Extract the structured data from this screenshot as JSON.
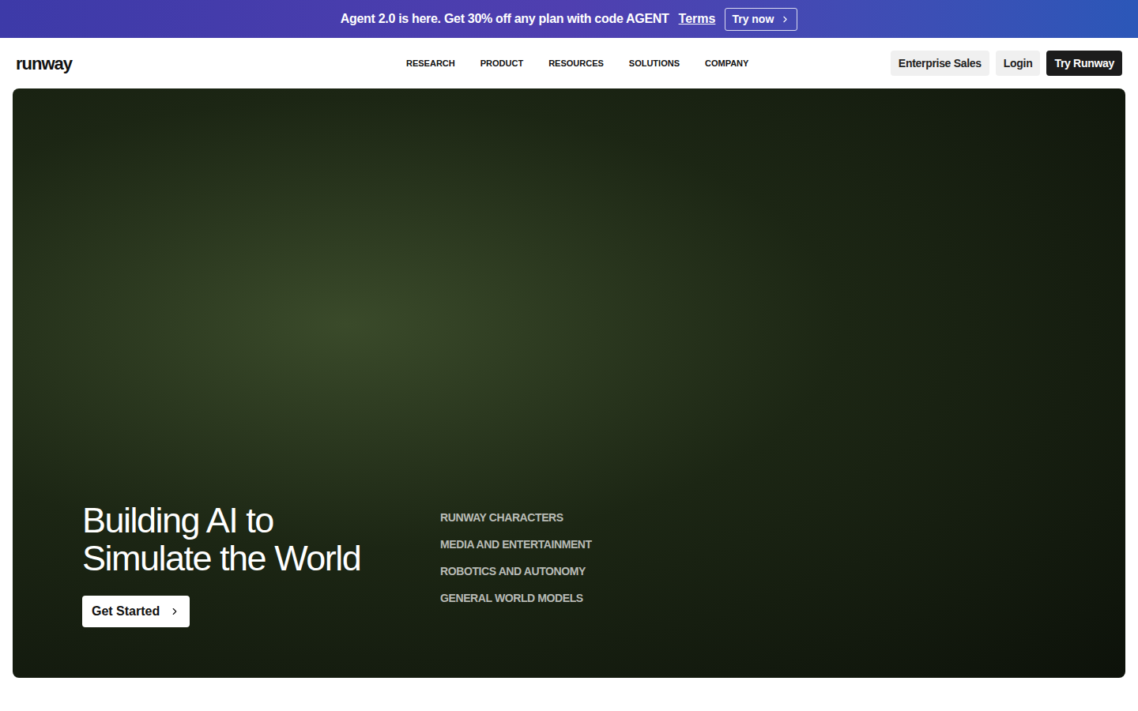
{
  "banner": {
    "text": "Agent 2.0 is here. Get 30% off any plan with code AGENT",
    "link": "Terms",
    "button": "Try now"
  },
  "nav": {
    "logo": "runway",
    "items": [
      "RESEARCH",
      "PRODUCT",
      "RESOURCES",
      "SOLUTIONS",
      "COMPANY"
    ],
    "buttons": [
      {
        "label": "Enterprise Sales",
        "kind": "secondary"
      },
      {
        "label": "Login",
        "kind": "secondary"
      },
      {
        "label": "Try Runway",
        "kind": "primary"
      }
    ]
  },
  "hero": {
    "title_lines": [
      "Building AI to",
      "Simulate the World"
    ],
    "cta": "Get Started",
    "links": [
      "RUNWAY CHARACTERS",
      "MEDIA AND ENTERTAINMENT",
      "ROBOTICS AND AUTONOMY",
      "GENERAL WORLD MODELS"
    ]
  }
}
